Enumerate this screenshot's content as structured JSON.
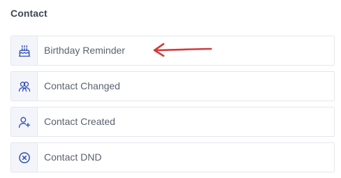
{
  "section": {
    "title": "Contact"
  },
  "items": [
    {
      "label": "Birthday Reminder",
      "icon": "birthday-cake-icon"
    },
    {
      "label": "Contact Changed",
      "icon": "users-icon"
    },
    {
      "label": "Contact Created",
      "icon": "user-plus-icon"
    },
    {
      "label": "Contact DND",
      "icon": "dnd-circle-x-icon"
    }
  ],
  "colors": {
    "icon": "#2f4fb5",
    "arrow": "#d23b3b",
    "label": "#5b6270",
    "title": "#3f4654"
  }
}
